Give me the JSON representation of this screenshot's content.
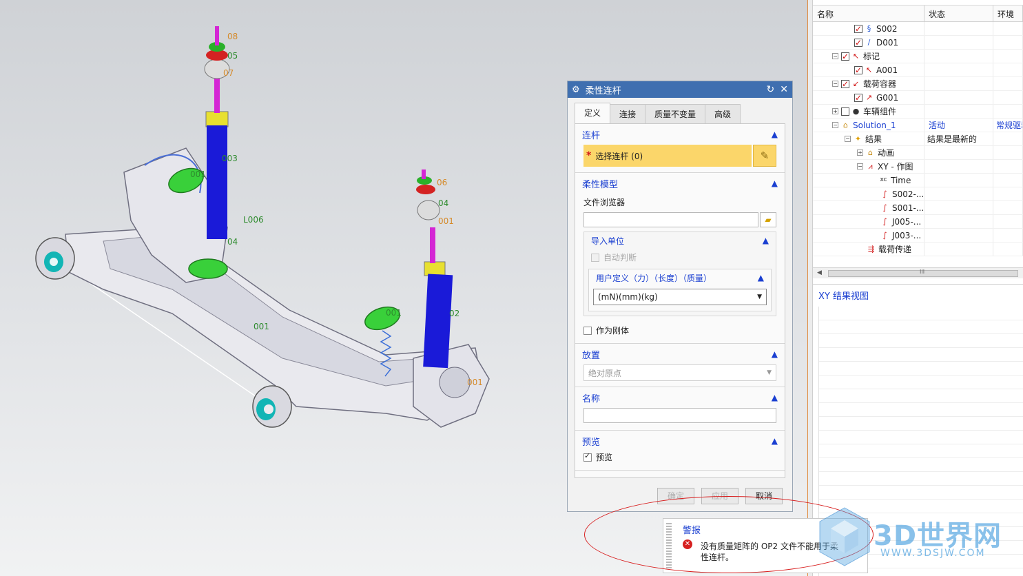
{
  "viewport": {
    "labels_green": [
      "L006",
      "001",
      "02",
      "003",
      "04",
      "05",
      "04"
    ],
    "labels_orange": [
      "08",
      "07",
      "06",
      "001",
      "001"
    ],
    "label_extra": [
      "001",
      "001"
    ]
  },
  "tree": {
    "columns": [
      "名称",
      "状态",
      "环境"
    ],
    "rows": [
      {
        "label": "S002",
        "status": "",
        "env": ""
      },
      {
        "label": "D001",
        "status": "",
        "env": ""
      },
      {
        "label": "标记",
        "status": "",
        "env": ""
      },
      {
        "label": "A001",
        "status": "",
        "env": ""
      },
      {
        "label": "载荷容器",
        "status": "",
        "env": ""
      },
      {
        "label": "G001",
        "status": "",
        "env": ""
      },
      {
        "label": "车辆组件",
        "status": "",
        "env": ""
      },
      {
        "label": "Solution_1",
        "status": "活动",
        "env": "常规驱动"
      },
      {
        "label": "结果",
        "status": "结果是最新的",
        "env": ""
      },
      {
        "label": "动画",
        "status": "",
        "env": ""
      },
      {
        "label": "XY - 作图",
        "status": "",
        "env": ""
      },
      {
        "label": "Time",
        "status": "",
        "env": ""
      },
      {
        "label": "S002-...",
        "status": "",
        "env": ""
      },
      {
        "label": "S001-...",
        "status": "",
        "env": ""
      },
      {
        "label": "J005-...",
        "status": "",
        "env": ""
      },
      {
        "label": "J003-...",
        "status": "",
        "env": ""
      },
      {
        "label": "载荷传递",
        "status": "",
        "env": ""
      }
    ],
    "scroll_grip": "III"
  },
  "xy_view": {
    "title": "XY 结果视图"
  },
  "dialog": {
    "title": "柔性连杆",
    "tabs": [
      "定义",
      "连接",
      "质量不变量",
      "高级"
    ],
    "sections": {
      "link": {
        "title": "连杆",
        "select_label": "选择连杆 (0)"
      },
      "flex_model": {
        "title": "柔性模型",
        "file_browser_label": "文件浏览器",
        "file_value": "",
        "import_units": {
          "title": "导入单位",
          "auto_detect": "自动判断",
          "user_defined": {
            "title": "用户定义（力）（长度）（质量）",
            "selected": "(mN)(mm)(kg)"
          }
        },
        "as_rigid": "作为刚体"
      },
      "placement": {
        "title": "放置",
        "selected": "绝对原点"
      },
      "name": {
        "title": "名称",
        "value": ""
      },
      "preview": {
        "title": "预览",
        "checkbox": "预览"
      }
    },
    "buttons": {
      "ok": "确定",
      "apply": "应用",
      "cancel": "取消"
    }
  },
  "alert": {
    "title": "警报",
    "message": "没有质量矩阵的 OP2 文件不能用于柔性连杆。"
  },
  "watermark": {
    "brand": "3D世界网",
    "url": "WWW.3DSJW.COM"
  },
  "colors": {
    "accent": "#1a3fd1",
    "titlebar": "#3f6fb0",
    "highlight": "#fbd66a",
    "error": "#d62020"
  }
}
